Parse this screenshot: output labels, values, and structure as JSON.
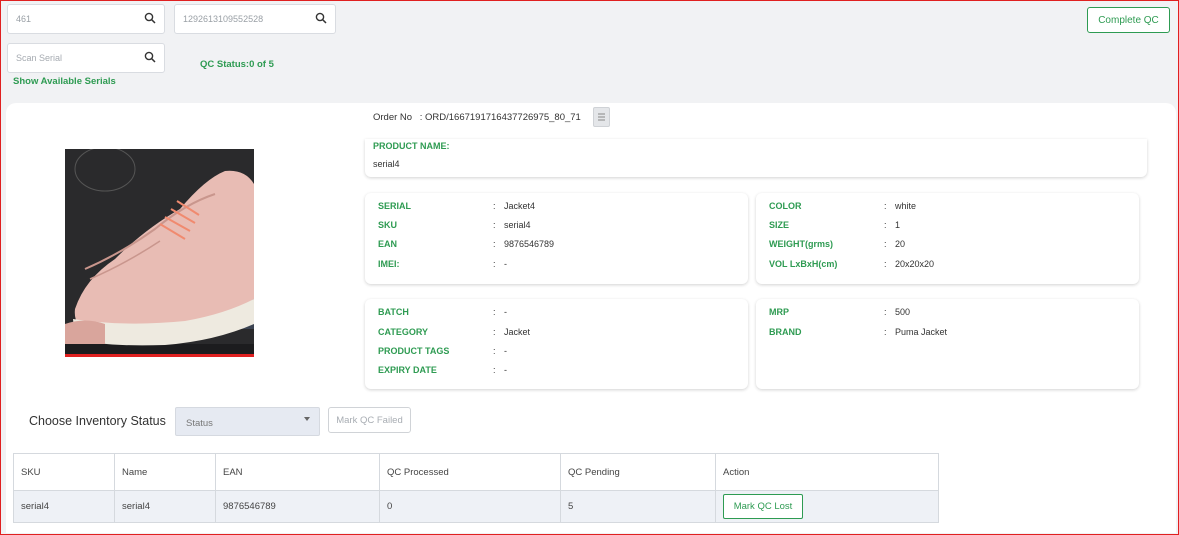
{
  "search": {
    "field1_value": "461",
    "field2_value": "1292613109552528",
    "scan_placeholder": "Scan Serial"
  },
  "show_serials_label": "Show Available Serials",
  "qc_status": "QC Status:0 of 5",
  "complete_qc_label": "Complete QC",
  "order": {
    "label": "Order No",
    "separator": ":",
    "value": "ORD/1667191716437726975_80_71"
  },
  "product": {
    "name_label": "PRODUCT NAME:",
    "name_value": "serial4"
  },
  "details_left": [
    {
      "label": "SERIAL",
      "value": "Jacket4"
    },
    {
      "label": "SKU",
      "value": "serial4"
    },
    {
      "label": "EAN",
      "value": "9876546789"
    },
    {
      "label": "IMEI:",
      "value": "-"
    }
  ],
  "details_right": [
    {
      "label": "COLOR",
      "value": "white"
    },
    {
      "label": "SIZE",
      "value": "1"
    },
    {
      "label": "WEIGHT(grms)",
      "value": "20"
    },
    {
      "label": "VOL LxBxH(cm)",
      "value": "20x20x20"
    }
  ],
  "details_left2": [
    {
      "label": "BATCH",
      "value": "-"
    },
    {
      "label": "CATEGORY",
      "value": "Jacket"
    },
    {
      "label": "PRODUCT TAGS",
      "value": "-"
    },
    {
      "label": "EXPIRY DATE",
      "value": "-"
    }
  ],
  "details_right2": [
    {
      "label": "MRP",
      "value": "500"
    },
    {
      "label": "BRAND",
      "value": "Puma Jacket"
    }
  ],
  "colon": ":",
  "inventory": {
    "label": "Choose Inventory Status",
    "select_value": "Status",
    "mark_failed_label": "Mark QC Failed"
  },
  "table": {
    "headers": [
      "SKU",
      "Name",
      "EAN",
      "QC Processed",
      "QC Pending",
      "Action"
    ],
    "rows": [
      {
        "sku": "serial4",
        "name": "serial4",
        "ean": "9876546789",
        "processed": "0",
        "pending": "5",
        "action": "Mark QC Lost"
      }
    ]
  },
  "colors": {
    "accent_green": "#2e9b52",
    "frame_red": "#e02020",
    "background": "#f1f2f4"
  },
  "icons": [
    "search-icon",
    "copy-icon",
    "chevron-down-icon"
  ]
}
